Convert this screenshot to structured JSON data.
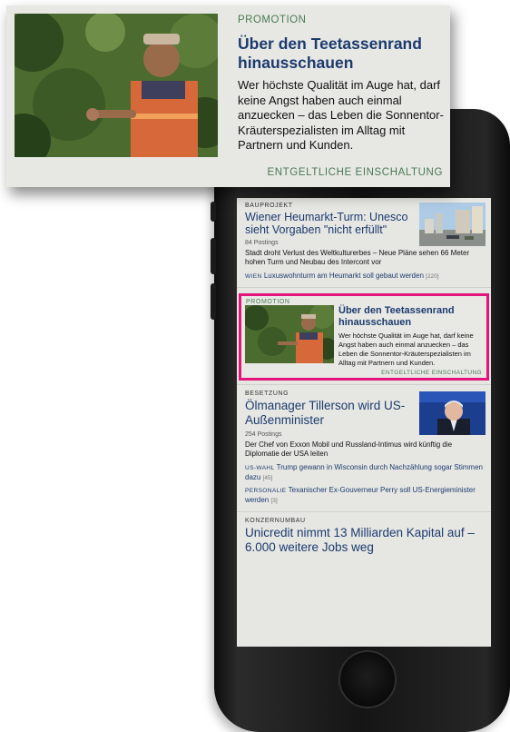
{
  "callout": {
    "kicker": "PROMOTION",
    "headline": "Über den Teetassenrand hinausschauen",
    "text": "Wer höchste Qualität im Auge hat, darf keine Angst haben auch einmal anzuecken – das Leben die Sonnentor-Kräuterspezialisten im Alltag mit Partnern und Kunden.",
    "footer": "ENTGELTLICHE EINSCHALTUNG"
  },
  "feed": {
    "article1": {
      "kicker": "BAUPROJEKT",
      "headline": "Wiener Heumarkt-Turm: Unesco sieht Vorgaben \"nicht erfüllt\"",
      "postings": "84 Postings",
      "teaser": "Stadt droht Verlust des Weltkulturerbes – Neue Pläne sehen 66 Meter hohen Turm und Neubau des Intercont vor",
      "related": [
        {
          "tag": "WIEN",
          "text": "Luxuswohnturm am Heumarkt soll gebaut werden",
          "count": "[220]"
        }
      ]
    },
    "promo": {
      "kicker": "PROMOTION",
      "headline": "Über den Teetassenrand hinausschauen",
      "text": "Wer höchste Qualität im Auge hat, darf keine Angst haben auch einmal anzuecken – das Leben die Sonnentor-Kräuterspezialisten im Alltag mit Partnern und Kunden.",
      "footer": "ENTGELTLICHE EINSCHALTUNG"
    },
    "article2": {
      "kicker": "BESETZUNG",
      "headline": "Ölmanager Tillerson wird US-Außenminister",
      "postings": "254 Postings",
      "teaser": "Der Chef von Exxon Mobil und Russland-Intimus wird künftig die Diplomatie der USA leiten",
      "related": [
        {
          "tag": "US-WAHL",
          "text": "Trump gewann in Wisconsin durch Nachzählung sogar Stimmen dazu",
          "count": "[45]"
        },
        {
          "tag": "PERSONALIE",
          "text": "Texanischer Ex-Gouverneur Perry soll US-Energieminister werden",
          "count": "[3]"
        }
      ]
    },
    "article3": {
      "kicker": "KONZERNUMBAU",
      "headline": "Unicredit nimmt 13 Milliarden Kapital auf – 6.000 weitere Jobs weg"
    }
  },
  "colors": {
    "headline": "#1c3a6e",
    "kicker_green": "#4a7a52",
    "highlight_border": "#e3147a",
    "card_bg": "#e7e8e4"
  },
  "images": {
    "promo_photo": "coffee-farmer-photo",
    "article1_photo": "city-buildings-photo",
    "article2_photo": "tillerson-portrait-photo"
  }
}
